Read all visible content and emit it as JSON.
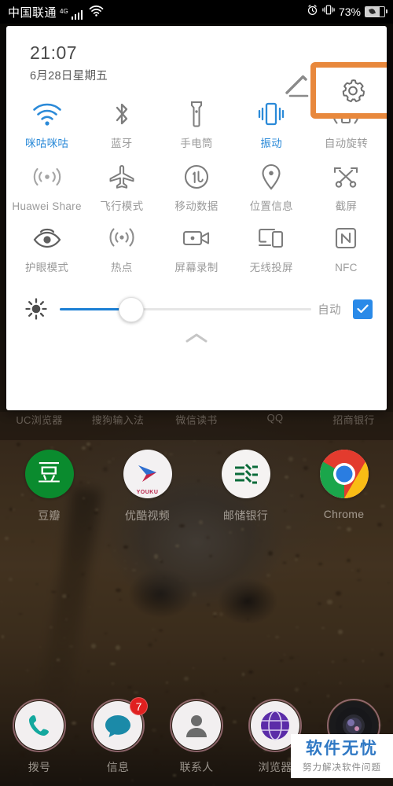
{
  "statusbar": {
    "carrier": "中国联通",
    "network": "4G",
    "signal_icon": "signal-bars-icon",
    "wifi_icon": "wifi-icon",
    "alarm_icon": "alarm-clock-icon",
    "vibrate_icon": "vibrate-icon",
    "battery_percent": "73%",
    "battery_icon": "battery-saver-icon",
    "battery_level": 73
  },
  "panel": {
    "time": "21:07",
    "date": "6月28日星期五",
    "edit_icon": "pencil-edit-icon",
    "settings_icon": "gear-icon",
    "highlight_color": "#e8883c",
    "active_color": "#2b8ad8",
    "tiles": [
      [
        {
          "label": "咪咕咪咕",
          "icon": "wifi-icon",
          "active": true
        },
        {
          "label": "蓝牙",
          "icon": "bluetooth-icon",
          "active": false
        },
        {
          "label": "手电筒",
          "icon": "flashlight-icon",
          "active": false
        },
        {
          "label": "振动",
          "icon": "vibrate-icon",
          "active": true
        },
        {
          "label": "自动旋转",
          "icon": "auto-rotate-icon",
          "active": false
        }
      ],
      [
        {
          "label": "Huawei Share",
          "icon": "huawei-share-icon",
          "active": false
        },
        {
          "label": "飞行模式",
          "icon": "airplane-icon",
          "active": false
        },
        {
          "label": "移动数据",
          "icon": "mobile-data-icon",
          "active": false
        },
        {
          "label": "位置信息",
          "icon": "location-pin-icon",
          "active": false
        },
        {
          "label": "截屏",
          "icon": "screenshot-scissors-icon",
          "active": false
        }
      ],
      [
        {
          "label": "护眼模式",
          "icon": "eye-comfort-icon",
          "active": false
        },
        {
          "label": "热点",
          "icon": "hotspot-icon",
          "active": false
        },
        {
          "label": "屏幕录制",
          "icon": "screen-record-icon",
          "active": false
        },
        {
          "label": "无线投屏",
          "icon": "cast-screen-icon",
          "active": false
        },
        {
          "label": "NFC",
          "icon": "nfc-icon",
          "active": false
        }
      ]
    ],
    "brightness": {
      "icon": "brightness-sun-icon",
      "value_percent": 28,
      "auto_label": "自动",
      "auto_checked": true,
      "check_icon": "check-icon"
    },
    "collapse_icon": "chevron-up-icon"
  },
  "home": {
    "hidden_row_labels": [
      "UC浏览器",
      "搜狗输入法",
      "微信读书",
      "QQ",
      "招商银行"
    ],
    "apps": [
      {
        "label": "豆瓣",
        "icon": "douban-icon",
        "glyph": "豆"
      },
      {
        "label": "优酷视频",
        "icon": "youku-icon",
        "glyph": "YOUKU"
      },
      {
        "label": "邮储银行",
        "icon": "postal-bank-icon",
        "glyph": "⊞"
      },
      {
        "label": "Chrome",
        "icon": "chrome-icon",
        "glyph": ""
      }
    ],
    "dock": [
      {
        "label": "拨号",
        "icon": "phone-icon",
        "badge": ""
      },
      {
        "label": "信息",
        "icon": "message-icon",
        "badge": "7"
      },
      {
        "label": "联系人",
        "icon": "contacts-icon",
        "badge": ""
      },
      {
        "label": "浏览器",
        "icon": "browser-globe-icon",
        "badge": ""
      },
      {
        "label": "",
        "icon": "camera-icon",
        "badge": ""
      }
    ]
  },
  "watermark": {
    "title": "软件无忧",
    "subtitle": "努力解决软件问题",
    "color": "#2f78c4"
  }
}
